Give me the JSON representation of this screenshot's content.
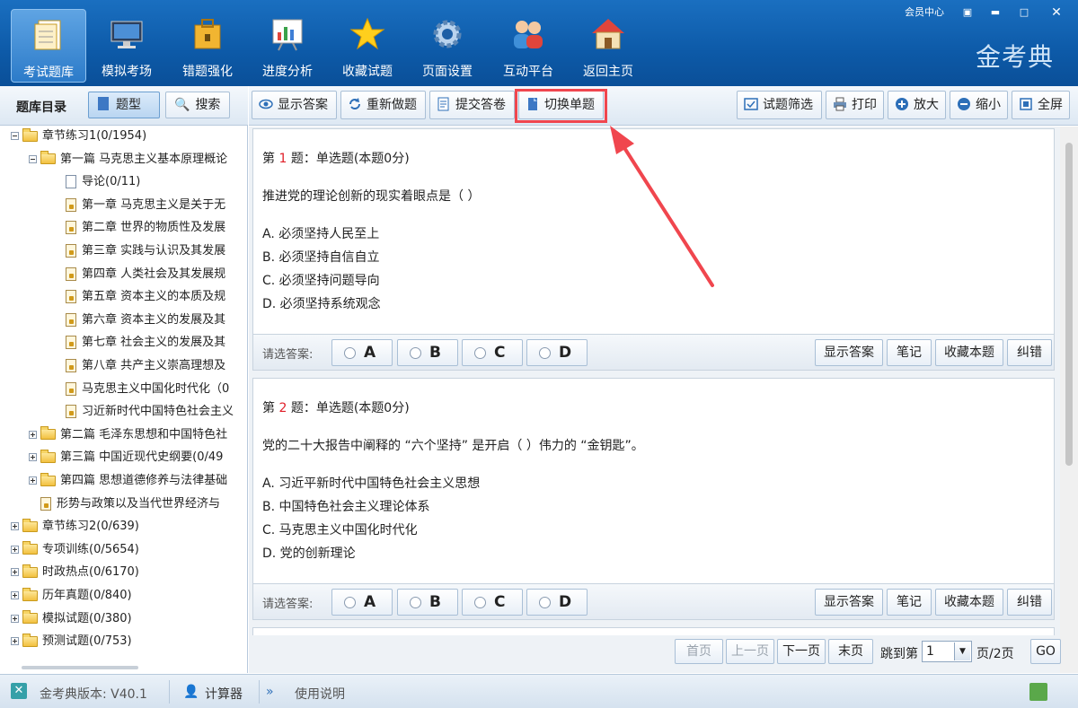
{
  "header": {
    "nav": [
      {
        "label": "考试题库",
        "icon": "question-bank-icon",
        "active": true
      },
      {
        "label": "模拟考场",
        "icon": "monitor-icon"
      },
      {
        "label": "错题强化",
        "icon": "lock-bag-icon"
      },
      {
        "label": "进度分析",
        "icon": "chart-board-icon"
      },
      {
        "label": "收藏试题",
        "icon": "star-icon"
      },
      {
        "label": "页面设置",
        "icon": "gear-icon"
      },
      {
        "label": "互动平台",
        "icon": "people-icon"
      },
      {
        "label": "返回主页",
        "icon": "home-icon"
      }
    ],
    "member": "会员中心",
    "brand": "金考典"
  },
  "sidebar": {
    "title": "题库目录",
    "tab_type": "题型",
    "tab_search": "搜索",
    "tree": [
      {
        "label": "章节练习1(0/1954)",
        "level": 0,
        "kind": "folder",
        "exp": "minus"
      },
      {
        "label": "第一篇 马克思主义基本原理概论",
        "level": 1,
        "kind": "folder",
        "exp": "minus"
      },
      {
        "label": "导论(0/11)",
        "level": 2,
        "kind": "doc"
      },
      {
        "label": "第一章 马克思主义是关于无",
        "level": 2,
        "kind": "lock"
      },
      {
        "label": "第二章 世界的物质性及发展",
        "level": 2,
        "kind": "lock"
      },
      {
        "label": "第三章 实践与认识及其发展",
        "level": 2,
        "kind": "lock"
      },
      {
        "label": "第四章 人类社会及其发展规",
        "level": 2,
        "kind": "lock"
      },
      {
        "label": "第五章 资本主义的本质及规",
        "level": 2,
        "kind": "lock"
      },
      {
        "label": "第六章 资本主义的发展及其",
        "level": 2,
        "kind": "lock"
      },
      {
        "label": "第七章 社会主义的发展及其",
        "level": 2,
        "kind": "lock"
      },
      {
        "label": "第八章 共产主义崇高理想及",
        "level": 2,
        "kind": "lock"
      },
      {
        "label": "马克思主义中国化时代化（0",
        "level": 2,
        "kind": "lock"
      },
      {
        "label": "习近新时代中国特色社会主义",
        "level": 2,
        "kind": "lock"
      },
      {
        "label": "第二篇 毛泽东思想和中国特色社",
        "level": 1,
        "kind": "folder",
        "exp": "plus"
      },
      {
        "label": "第三篇 中国近现代史纲要(0/49",
        "level": 1,
        "kind": "folder",
        "exp": "plus"
      },
      {
        "label": "第四篇 思想道德修养与法律基础",
        "level": 1,
        "kind": "folder",
        "exp": "plus"
      },
      {
        "label": "形势与政策以及当代世界经济与",
        "level": 1,
        "kind": "lock"
      },
      {
        "label": "章节练习2(0/639)",
        "level": 0,
        "kind": "folder",
        "exp": "plus"
      },
      {
        "label": "专项训练(0/5654)",
        "level": 0,
        "kind": "folder",
        "exp": "plus"
      },
      {
        "label": "时政热点(0/6170)",
        "level": 0,
        "kind": "folder",
        "exp": "plus"
      },
      {
        "label": "历年真题(0/840)",
        "level": 0,
        "kind": "folder",
        "exp": "plus"
      },
      {
        "label": "模拟试题(0/380)",
        "level": 0,
        "kind": "folder",
        "exp": "plus"
      },
      {
        "label": "预测试题(0/753)",
        "level": 0,
        "kind": "folder",
        "exp": "plus"
      }
    ]
  },
  "toolbar": {
    "show_answer": "显示答案",
    "redo": "重新做题",
    "submit": "提交答卷",
    "switch_single": "切换单题",
    "filter": "试题筛选",
    "print": "打印",
    "zoom_in": "放大",
    "zoom_out": "缩小",
    "fullscreen": "全屏"
  },
  "questions": [
    {
      "prefix": "第",
      "num": "1",
      "suffix": "题：单选题(本题0分)",
      "stem": "推进党的理论创新的现实着眼点是（ ）",
      "options": [
        "A. 必须坚持人民至上",
        "B. 必须坚持自信自立",
        "C. 必须坚持问题导向",
        "D. 必须坚持系统观念"
      ]
    },
    {
      "prefix": "第",
      "num": "2",
      "suffix": "题：单选题(本题0分)",
      "stem": "党的二十大报告中阐释的 “六个坚持” 是开启（ ）伟力的 “金钥匙”。",
      "options": [
        "A. 习近平新时代中国特色社会主义思想",
        "B. 中国特色社会主义理论体系",
        "C. 马克思主义中国化时代化",
        "D. 党的创新理论"
      ]
    }
  ],
  "answer_bar": {
    "label": "请选答案:",
    "choices": [
      "A",
      "B",
      "C",
      "D"
    ],
    "show_answer": "显示答案",
    "note": "笔记",
    "favorite": "收藏本题",
    "correct": "纠错"
  },
  "pager": {
    "first": "首页",
    "prev": "上一页",
    "next": "下一页",
    "last": "末页",
    "jump_to": "跳到第",
    "page_value": "1",
    "page_suffix": "页/2页",
    "go": "GO"
  },
  "status": {
    "version": "金考典版本: V40.1",
    "calculator": "计算器",
    "manual": "使用说明"
  },
  "colors": {
    "header": "#0d5aa8",
    "highlight": "#f0464e",
    "question_number": "#e0202a"
  }
}
